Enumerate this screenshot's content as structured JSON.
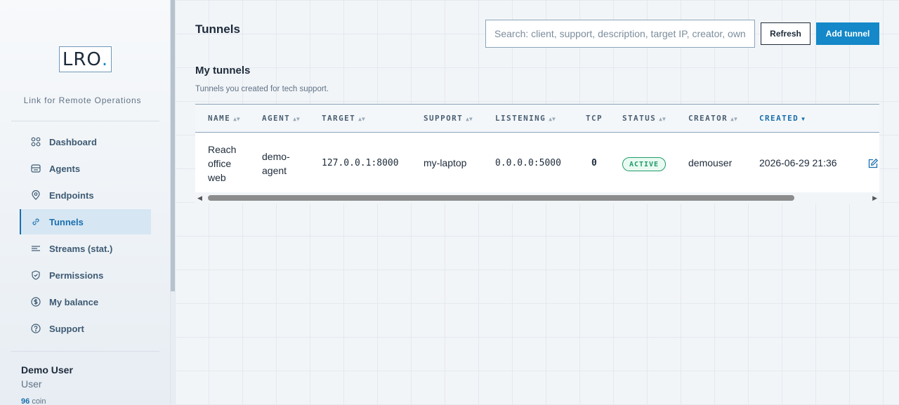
{
  "brand": {
    "logo_text": "LRO",
    "logo_dot": ".",
    "tagline": "Link for Remote Operations",
    "accent": "#1488c8"
  },
  "sidebar": {
    "items": [
      {
        "label": "Dashboard",
        "icon": "dashboard-icon"
      },
      {
        "label": "Agents",
        "icon": "agents-icon"
      },
      {
        "label": "Endpoints",
        "icon": "map-pin-icon"
      },
      {
        "label": "Tunnels",
        "icon": "link-icon",
        "active": true
      },
      {
        "label": "Streams (stat.)",
        "icon": "streams-icon"
      },
      {
        "label": "Permissions",
        "icon": "shield-icon"
      },
      {
        "label": "My balance",
        "icon": "dollar-icon"
      },
      {
        "label": "Support",
        "icon": "help-icon"
      }
    ],
    "user": {
      "name": "Demo User",
      "role": "User",
      "balance_value": "96",
      "balance_unit": "coin"
    }
  },
  "header": {
    "title": "Tunnels",
    "search_placeholder": "Search: client, support, description, target IP, creator, owner",
    "refresh_label": "Refresh",
    "add_label": "Add tunnel"
  },
  "section": {
    "title": "My tunnels",
    "subtitle": "Tunnels you created for tech support."
  },
  "table": {
    "columns": [
      "NAME",
      "AGENT",
      "TARGET",
      "SUPPORT",
      "LISTENING",
      "TCP",
      "STATUS",
      "CREATOR",
      "CREATED"
    ],
    "sorted_column": "CREATED",
    "rows": [
      {
        "name_lines": [
          "Reach",
          "office",
          "web"
        ],
        "agent_lines": [
          "demo-",
          "agent"
        ],
        "target": "127.0.0.1:8000",
        "support": "my-laptop",
        "listening": "0.0.0.0:5000",
        "tcp": "0",
        "status": "ACTIVE",
        "creator": "demouser",
        "created": "2026-06-29 21:36"
      }
    ]
  },
  "colors": {
    "status_active": "#1e9c6a",
    "primary": "#1488c8"
  }
}
